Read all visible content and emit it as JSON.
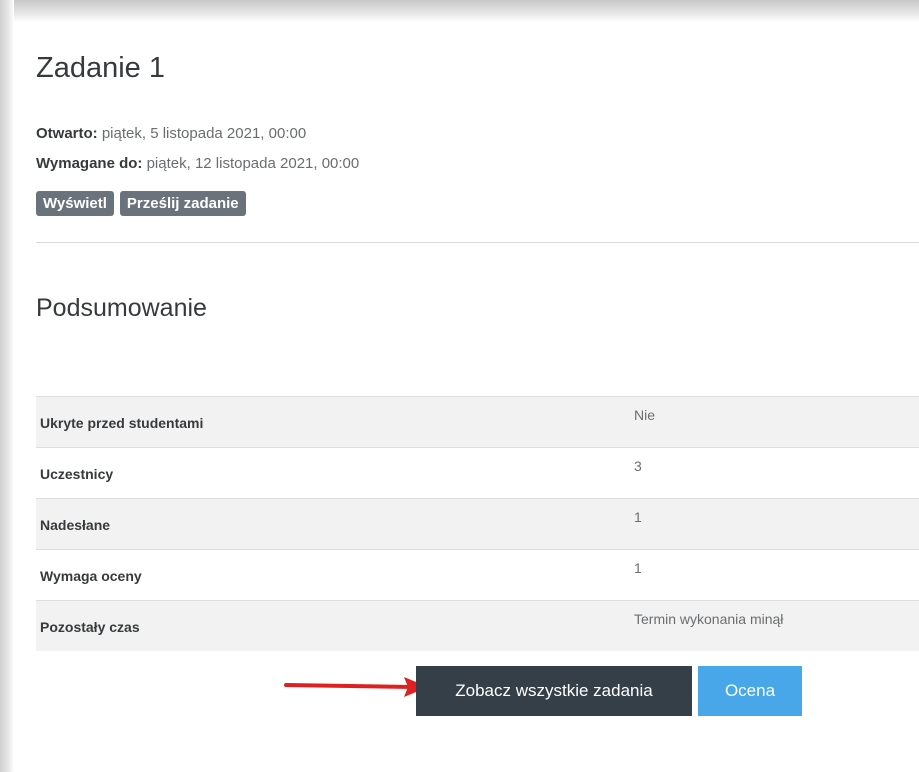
{
  "assignment": {
    "title": "Zadanie 1",
    "opened_label": "Otwarto:",
    "opened_value": "piątek, 5 listopada 2021, 00:00",
    "due_label": "Wymagane do:",
    "due_value": "piątek, 12 listopada 2021, 00:00",
    "badges": [
      "Wyświetl",
      "Prześlij zadanie"
    ]
  },
  "summary": {
    "heading": "Podsumowanie",
    "rows": [
      {
        "label": "Ukryte przed studentami",
        "value": "Nie"
      },
      {
        "label": "Uczestnicy",
        "value": "3"
      },
      {
        "label": "Nadesłane",
        "value": "1"
      },
      {
        "label": "Wymaga oceny",
        "value": "1"
      },
      {
        "label": "Pozostały czas",
        "value": "Termin wykonania minął"
      }
    ]
  },
  "actions": {
    "view_all_label": "Zobacz wszystkie zadania",
    "grade_label": "Ocena"
  },
  "colors": {
    "dark_button": "#353f47",
    "blue_button": "#47a7e8",
    "badge": "#6a737b",
    "arrow": "#e02020"
  }
}
